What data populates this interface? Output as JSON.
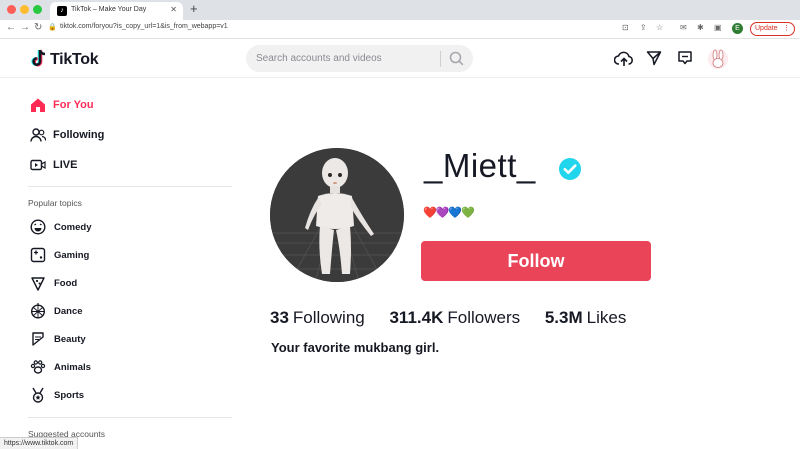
{
  "browser": {
    "tab_title": "TikTok – Make Your Day",
    "url": "tiktok.com/foryou?is_copy_url=1&is_from_webapp=v1",
    "profile_initial": "E",
    "update_label": "Update",
    "status_url": "https://www.tiktok.com"
  },
  "header": {
    "logo_text": "TikTok",
    "search_placeholder": "Search accounts and videos"
  },
  "sidebar": {
    "main_nav": [
      {
        "label": "For You",
        "icon": "home-icon",
        "active": true
      },
      {
        "label": "Following",
        "icon": "users-icon",
        "active": false
      },
      {
        "label": "LIVE",
        "icon": "live-icon",
        "active": false
      }
    ],
    "topics_title": "Popular topics",
    "topics": [
      {
        "label": "Comedy",
        "icon": "comedy-icon"
      },
      {
        "label": "Gaming",
        "icon": "gaming-icon"
      },
      {
        "label": "Food",
        "icon": "food-icon"
      },
      {
        "label": "Dance",
        "icon": "dance-icon"
      },
      {
        "label": "Beauty",
        "icon": "beauty-icon"
      },
      {
        "label": "Animals",
        "icon": "animals-icon"
      },
      {
        "label": "Sports",
        "icon": "sports-icon"
      }
    ],
    "suggested_title": "Suggested accounts"
  },
  "profile": {
    "username": "_Miett_",
    "verified": true,
    "hearts": "❤️💜💙💚",
    "follow_label": "Follow",
    "stats": [
      {
        "value": "33",
        "label": "Following"
      },
      {
        "value": "311.4K",
        "label": "Followers"
      },
      {
        "value": "5.3M",
        "label": "Likes"
      }
    ],
    "bio": "Your favorite mukbang girl."
  },
  "colors": {
    "accent": "#fe2c55",
    "follow_button": "#ea4459",
    "verified": "#20d5ec"
  }
}
